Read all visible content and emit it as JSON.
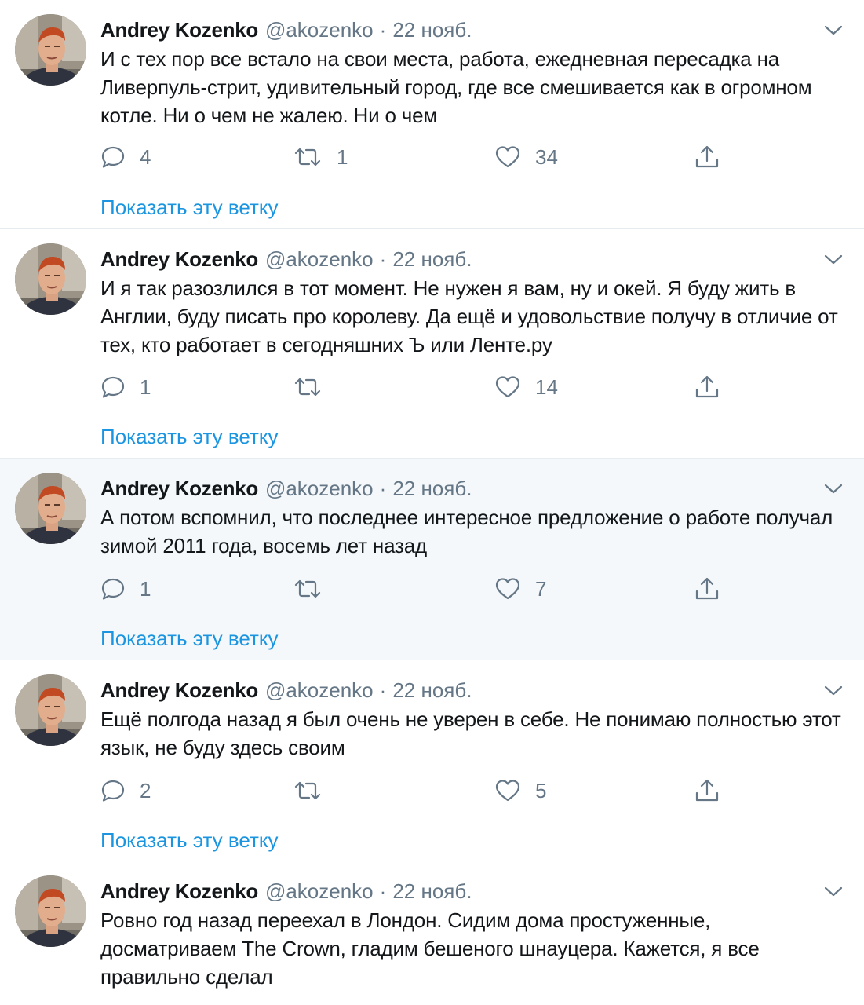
{
  "colors": {
    "accent": "#1b95e0",
    "muted": "#657786",
    "text": "#14171a",
    "highlight_bg": "#f5f8fa"
  },
  "icons": {
    "reply": "reply-icon",
    "retweet": "retweet-icon",
    "like": "heart-icon",
    "share": "share-icon",
    "more": "chevron-down-icon"
  },
  "tweets": [
    {
      "author": "Andrey Kozenko",
      "handle": "@akozenko",
      "sep": "·",
      "date": "22 нояб.",
      "text": "И с тех пор все встало на свои места, работа, ежедневная пересадка на Ливерпуль-стрит, удивительный город, где все смешивается как в огромном котле. Ни о чем не жалею. Ни о чем",
      "replies": "4",
      "retweets": "1",
      "likes": "34",
      "thread": "Показать эту ветку"
    },
    {
      "author": "Andrey Kozenko",
      "handle": "@akozenko",
      "sep": "·",
      "date": "22 нояб.",
      "text": "И я так разозлился в тот момент. Не нужен я вам, ну и окей. Я буду жить в Англии, буду писать про королеву. Да ещё и удовольствие получу в отличие от тех, кто работает в сегодняшних Ъ или Ленте.ру",
      "replies": "1",
      "retweets": "",
      "likes": "14",
      "thread": "Показать эту ветку"
    },
    {
      "author": "Andrey Kozenko",
      "handle": "@akozenko",
      "sep": "·",
      "date": "22 нояб.",
      "text": "А потом вспомнил, что последнее интересное предложение о работе получал зимой 2011 года, восемь лет назад",
      "replies": "1",
      "retweets": "",
      "likes": "7",
      "thread": "Показать эту ветку"
    },
    {
      "author": "Andrey Kozenko",
      "handle": "@akozenko",
      "sep": "·",
      "date": "22 нояб.",
      "text": "Ещё полгода назад я был очень не уверен в себе. Не понимаю полностью этот язык, не буду здесь своим",
      "replies": "2",
      "retweets": "",
      "likes": "5",
      "thread": "Показать эту ветку"
    },
    {
      "author": "Andrey Kozenko",
      "handle": "@akozenko",
      "sep": "·",
      "date": "22 нояб.",
      "text": "Ровно год назад переехал в Лондон. Сидим дома простуженные, досматриваем The Crown, гладим бешеного шнауцера. Кажется, я все правильно сделал"
    }
  ]
}
